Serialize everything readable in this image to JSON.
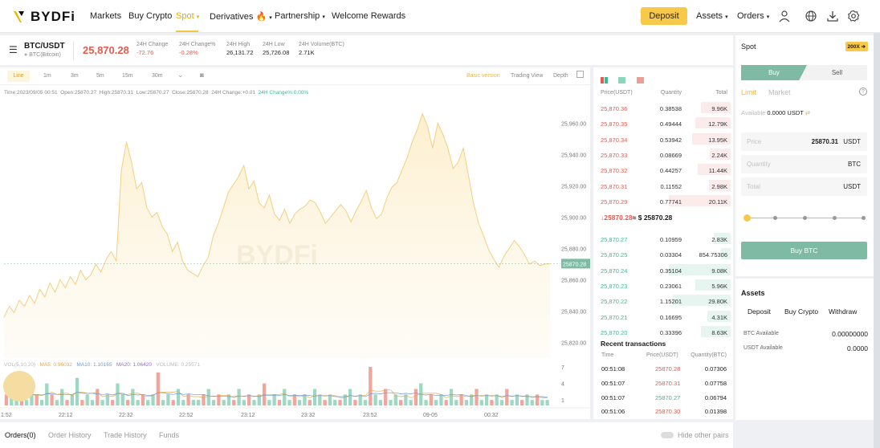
{
  "nav": {
    "logo_text": "BYDFi",
    "items": [
      "Markets",
      "Buy Crypto",
      "Spot",
      "Derivatives",
      "Partnership",
      "Welcome Rewards"
    ],
    "active": "Spot",
    "deposit": "Deposit",
    "assets": "Assets",
    "orders": "Orders",
    "icons": [
      "user-icon",
      "globe-icon",
      "download-icon",
      "settings-icon"
    ]
  },
  "ticker": {
    "pair": "BTC/USDT",
    "subtitle": "BTC(Bitcoin)",
    "price": "25,870.28",
    "stats": [
      {
        "label": "24H Change",
        "value": "-72.76",
        "color": "red"
      },
      {
        "label": "24H Change%",
        "value": "-0.28%",
        "color": "red"
      },
      {
        "label": "24H High",
        "value": "26,131.72",
        "color": "dark"
      },
      {
        "label": "24H Low",
        "value": "25,726.08",
        "color": "dark"
      },
      {
        "label": "24H Volume(BTC)",
        "value": "2.71K",
        "color": "dark"
      }
    ]
  },
  "chart_toolbar": {
    "intervals": [
      "Line",
      "1m",
      "3m",
      "5m",
      "15m",
      "30m"
    ],
    "active": "Line",
    "basic": "Basic version",
    "tradingview": "Trading View",
    "depth": "Depth"
  },
  "chart_info": {
    "time": "Time:2023/09/05 00:51",
    "open": "Open:25870.27",
    "high": "High:25870.31",
    "low": "Low:25870.27",
    "close": "Close:25870.28",
    "change": "24H Change:+0.01",
    "change_pct": "24H Change%:0.00%"
  },
  "ma": {
    "vol": "VOL(5,10,20)",
    "ma5": "MA5: 0.96032",
    "ma10": "MA10: 1.10165",
    "ma20": "MA20: 1.06420",
    "volume": "VOLUME: 0.25571"
  },
  "chart_data": {
    "type": "area",
    "y_ticks": [
      "25,960.00",
      "25,940.00",
      "25,920.00",
      "25,900.00",
      "25,880.00",
      "25,860.00",
      "25,840.00",
      "25,820.00"
    ],
    "current_price_label": "25870.28",
    "current_price": 25870.28,
    "x_ticks": [
      "1:52",
      "22:12",
      "22:32",
      "22:52",
      "23:12",
      "23:32",
      "23:52",
      "09-05",
      "00:32"
    ],
    "vol_ticks": [
      "7",
      "4",
      "1"
    ],
    "ylim": [
      25810,
      25975
    ],
    "price_series": [
      25836,
      25843,
      25839,
      25847,
      25843,
      25850,
      25845,
      25854,
      25849,
      25858,
      25852,
      25860,
      25855,
      25862,
      25857,
      25866,
      25860,
      25863,
      25870,
      25865,
      25873,
      25878,
      25872,
      25930,
      25948,
      25935,
      25918,
      25922,
      25906,
      25900,
      25903,
      25894,
      25889,
      25878,
      25884,
      25872,
      25866,
      25864,
      25862,
      25869,
      25874,
      25888,
      25896,
      25906,
      25916,
      25921,
      25926,
      25933,
      25918,
      25923,
      25909,
      25906,
      25914,
      25902,
      25898,
      25905,
      25896,
      25902,
      25905,
      25907,
      25911,
      25909,
      25903,
      25896,
      25900,
      25904,
      25908,
      25904,
      25897,
      25904,
      25910,
      25917,
      25906,
      25899,
      25902,
      25912,
      25919,
      25922,
      25930,
      25938,
      25948,
      25956,
      25966,
      25958,
      25944,
      25960,
      25953,
      25944,
      25931,
      25935,
      25944,
      25927,
      25909,
      25896,
      25888,
      25879,
      25873,
      25868,
      25875,
      25880,
      25885,
      25881,
      25876,
      25870,
      25872,
      25869,
      25870,
      25870.28
    ],
    "volume_series": [
      2,
      3,
      1,
      2,
      1,
      3,
      2,
      1,
      4,
      2,
      1,
      3,
      1,
      2,
      5,
      1,
      2,
      1,
      3,
      1,
      2,
      1,
      4,
      2,
      1,
      3,
      1,
      2,
      1,
      2,
      6,
      1,
      2,
      1,
      3,
      1,
      2,
      1,
      1,
      2,
      3,
      1,
      2,
      1,
      2,
      1,
      3,
      1,
      2,
      1,
      2,
      4,
      1,
      2,
      1,
      3,
      1,
      2,
      1,
      2,
      1,
      3,
      2,
      1,
      2,
      1,
      1,
      2,
      3,
      1,
      2,
      1,
      7,
      2,
      1,
      3,
      1,
      2,
      1,
      2,
      1,
      3,
      4,
      1,
      2,
      1,
      2,
      1,
      3,
      1,
      2,
      1,
      2,
      3,
      1,
      2,
      1,
      2,
      1,
      3,
      1,
      2,
      1,
      2,
      1,
      2,
      1,
      1
    ]
  },
  "book": {
    "headers": [
      "Price(USDT)",
      "Quantity",
      "Total"
    ],
    "asks": [
      {
        "price": "25,870.36",
        "qty": "0.38538",
        "total": "9.96K",
        "depth": 0.32
      },
      {
        "price": "25,870.35",
        "qty": "0.49444",
        "total": "12.79K",
        "depth": 0.38
      },
      {
        "price": "25,870.34",
        "qty": "0.53942",
        "total": "13.95K",
        "depth": 0.41
      },
      {
        "price": "25,870.33",
        "qty": "0.08669",
        "total": "2.24K",
        "depth": 0.22
      },
      {
        "price": "25,870.32",
        "qty": "0.44257",
        "total": "11.44K",
        "depth": 0.35
      },
      {
        "price": "25,870.31",
        "qty": "0.11552",
        "total": "2.98K",
        "depth": 0.23
      },
      {
        "price": "25,870.29",
        "qty": "0.77741",
        "total": "20.11K",
        "depth": 0.66
      }
    ],
    "mid_arrow_price": "↓25870.28",
    "mid_usd": "≈ $ 25870.28",
    "bids": [
      {
        "price": "25,870.27",
        "qty": "0.10959",
        "total": "2.83K",
        "depth": 0.18
      },
      {
        "price": "25,870.25",
        "qty": "0.03304",
        "total": "854.75306",
        "depth": 0.1
      },
      {
        "price": "25,870.24",
        "qty": "0.35104",
        "total": "9.08K",
        "depth": 0.66
      },
      {
        "price": "25,870.23",
        "qty": "0.23061",
        "total": "5.96K",
        "depth": 0.38
      },
      {
        "price": "25,870.22",
        "qty": "1.15201",
        "total": "29.80K",
        "depth": 0.62
      },
      {
        "price": "25,870.21",
        "qty": "0.16695",
        "total": "4.31K",
        "depth": 0.25
      },
      {
        "price": "25,870.20",
        "qty": "0.33396",
        "total": "8.63K",
        "depth": 0.32
      }
    ]
  },
  "recent": {
    "title": "Recent transactions",
    "headers": [
      "Time",
      "Price(USDT)",
      "Quantity(BTC)"
    ],
    "rows": [
      {
        "time": "00:51:08",
        "price": "25870.28",
        "qty": "0.07306",
        "side": "red"
      },
      {
        "time": "00:51:07",
        "price": "25870.31",
        "qty": "0.07758",
        "side": "red"
      },
      {
        "time": "00:51:07",
        "price": "25870.27",
        "qty": "0.06794",
        "side": "green"
      },
      {
        "time": "00:51:06",
        "price": "25870.30",
        "qty": "0.01398",
        "side": "red"
      }
    ]
  },
  "order": {
    "title": "Spot",
    "leverage": "200X",
    "buy": "Buy",
    "sell": "Sell",
    "limit": "Limit",
    "market": "Market",
    "available_label": "Available",
    "available_value": "0.0000 USDT",
    "price_label": "Price",
    "price_value": "25870.31",
    "price_unit": "USDT",
    "qty_label": "Quantity",
    "qty_unit": "BTC",
    "total_label": "Total",
    "total_unit": "USDT",
    "submit": "Buy BTC",
    "slider_value": 0
  },
  "assets": {
    "title": "Assets",
    "buttons": [
      "Deposit",
      "Buy Crypto",
      "Withdraw"
    ],
    "btc_label": "BTC Available",
    "btc_value": "0.00000000",
    "usdt_label": "USDT Available",
    "usdt_value": "0.0000"
  },
  "bottom": {
    "tabs": [
      "Orders(0)",
      "Order History",
      "Trade History",
      "Funds"
    ],
    "hide": "Hide other pairs"
  },
  "colors": {
    "accent": "#f5c542",
    "red": "#e35b4f",
    "green": "#3dbb8f",
    "teal": "#7fbba4"
  }
}
